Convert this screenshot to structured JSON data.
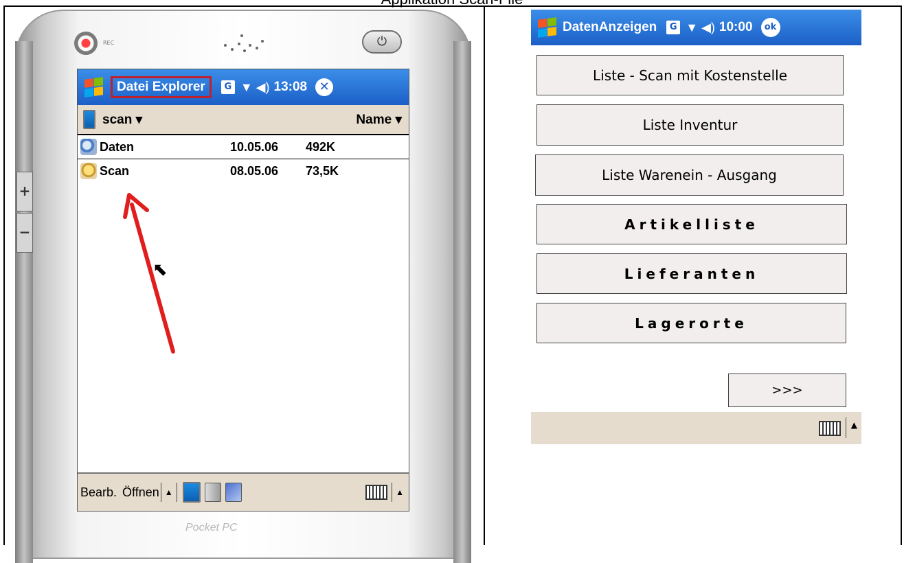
{
  "page_heading": "Applikation Scan-File",
  "device": {
    "rec_label": "REC",
    "brand_label": "Pocket PC",
    "titlebar": {
      "title": "Datei Explorer",
      "g_label": "G",
      "signal_glyph": "Y̲|",
      "speaker_glyph": "◀€",
      "time": "13:08",
      "close_glyph": "✕"
    },
    "folderbar": {
      "folder": "scan ▾",
      "sort": "Name ▾"
    },
    "files": [
      {
        "name": "Daten",
        "date": "10.05.06",
        "size": "492K",
        "icon": "database-icon"
      },
      {
        "name": "Scan",
        "date": "08.05.06",
        "size": "73,5K",
        "icon": "scan-app-icon"
      }
    ],
    "bottombar": {
      "edit": "Bearb.",
      "open": "Öffnen",
      "up_arrow": "▲"
    }
  },
  "app": {
    "title": "DatenAnzeigen",
    "g_label": "G",
    "time": "10:00",
    "ok": "ok",
    "buttons": [
      "Liste - Scan mit Kostenstelle",
      "Liste Inventur",
      "Liste Warenein - Ausgang",
      "Artikelliste",
      "Lieferanten",
      "Lagerorte"
    ],
    "next": ">>>",
    "up_arrow": "▲"
  },
  "colors": {
    "titlebar": "#1c5fc7",
    "highlight_box": "#c0202a",
    "annotation_arrow": "#e01e1e",
    "bar_beige": "#e6dccd",
    "button_face": "#f2eeee"
  }
}
